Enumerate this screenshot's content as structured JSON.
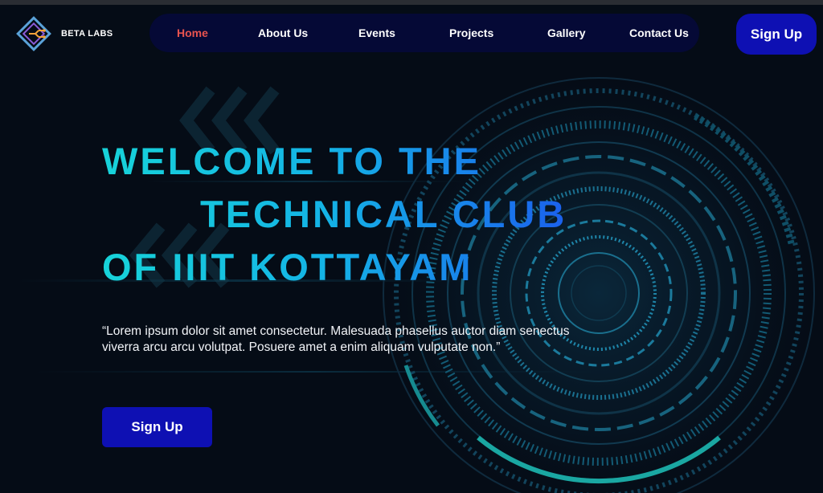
{
  "brand": {
    "name": "BETA LABS"
  },
  "nav": {
    "items": [
      {
        "label": "Home",
        "active": true
      },
      {
        "label": "About Us"
      },
      {
        "label": "Events"
      },
      {
        "label": "Projects"
      },
      {
        "label": "Gallery"
      },
      {
        "label": "Contact Us"
      }
    ]
  },
  "header": {
    "signup_label": "Sign Up"
  },
  "hero": {
    "title_lines": [
      "WELCOME TO THE",
      "TECHNICAL CLUB",
      "OF IIIT KOTTAYAM"
    ],
    "description": "“Lorem ipsum dolor sit amet consectetur. Malesuada phasellus auctor diam senectus viverra arcu arcu volutpat. Posuere amet a enim aliquam vulputate non.”",
    "cta_label": "Sign Up"
  },
  "colors": {
    "background": "#050c16",
    "nav_background": "#050936",
    "button": "#0e10b3",
    "active_nav": "#e8534f",
    "title_gradient_start": "#17d3d9",
    "title_gradient_end": "#1c55ee"
  },
  "icons": {
    "logo": "diamond-circuit-logo-icon",
    "background": "tech-ring-pattern"
  }
}
